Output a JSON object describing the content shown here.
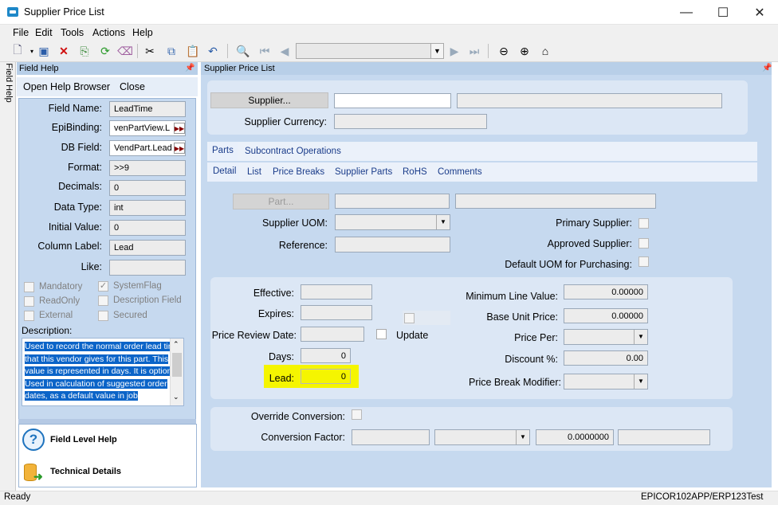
{
  "window": {
    "title": "Supplier Price List",
    "minimize": "—",
    "maximize": "☐",
    "close": "✕"
  },
  "menu": [
    "File",
    "Edit",
    "Tools",
    "Actions",
    "Help"
  ],
  "dock": {
    "label": "Field Help"
  },
  "field_help": {
    "header": "Field Help",
    "open_browser": "Open Help Browser",
    "close": "Close",
    "labels": {
      "field_name": "Field Name:",
      "epibinding": "EpiBinding:",
      "db_field": "DB Field:",
      "format": "Format:",
      "decimals": "Decimals:",
      "data_type": "Data Type:",
      "initial_value": "Initial Value:",
      "column_label": "Column Label:",
      "like": "Like:"
    },
    "values": {
      "field_name": "LeadTime",
      "epibinding": "venPartView.L",
      "db_field": "VendPart.Lead",
      "format": ">>9",
      "decimals": "0",
      "data_type": "int",
      "initial_value": "0",
      "column_label": "Lead",
      "like": ""
    },
    "checks": {
      "mandatory": "Mandatory",
      "readonly": "ReadOnly",
      "external": "External",
      "systemflag": "SystemFlag",
      "description_field": "Description Field",
      "secured": "Secured"
    },
    "description_label": "Description:",
    "description": "Used to record the normal  order lead time that this vendor gives for this part. This value is represented in days. It is optional. Used in calculation of suggested order dates, as a default value in job",
    "field_level_help": "Field Level Help",
    "technical_details": "Technical Details"
  },
  "main": {
    "header": "Supplier Price List",
    "supplier_button": "Supplier...",
    "supplier_currency": "Supplier Currency:",
    "tabs_top": [
      "Parts",
      "Subcontract Operations"
    ],
    "tabs_sub": [
      "Detail",
      "List",
      "Price Breaks",
      "Supplier Parts",
      "RoHS",
      "Comments"
    ],
    "part_button": "Part...",
    "supplier_uom": "Supplier UOM:",
    "reference": "Reference:",
    "primary_supplier": "Primary Supplier:",
    "approved_supplier": "Approved Supplier:",
    "default_uom": "Default UOM for Purchasing:",
    "effective": "Effective:",
    "expires": "Expires:",
    "price_review_date": "Price Review Date:",
    "update": "Update",
    "days": "Days:",
    "days_value": "0",
    "lead": "Lead:",
    "lead_value": "0",
    "minimum_line_value": "Minimum Line Value:",
    "minimum_line_value_val": "0.00000",
    "base_unit_price": "Base Unit Price:",
    "base_unit_price_val": "0.00000",
    "price_per": "Price Per:",
    "discount": "Discount %:",
    "discount_val": "0.00",
    "price_break_modifier": "Price Break Modifier:",
    "override_conversion": "Override Conversion:",
    "conversion_factor": "Conversion Factor:",
    "conversion_factor_val": "0.0000000"
  },
  "status": {
    "left": "Ready",
    "right": "EPICOR102APP/ERP123Test"
  },
  "colors": {
    "highlight": "#f5f500",
    "panel": "#c6d9ef",
    "selection": "#0b64c8"
  }
}
